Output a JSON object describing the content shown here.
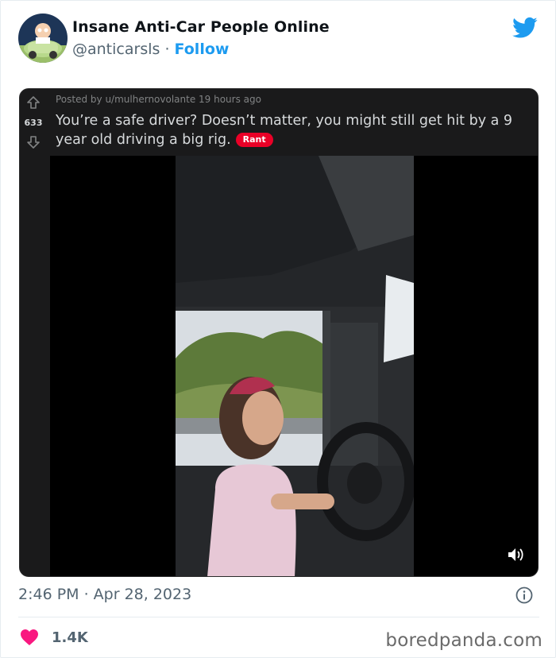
{
  "tweet": {
    "author_name": "Insane Anti-Car People Online",
    "handle": "@anticarsls",
    "separator": "·",
    "follow_label": "Follow",
    "timestamp": "2:46 PM · Apr 28, 2023",
    "like_count": "1.4K",
    "brand_color": "#1d9bf0",
    "like_color": "#f91880"
  },
  "reddit_post": {
    "score": "633",
    "meta": "Posted by u/mulhernovolante 19 hours ago",
    "title": "You’re a safe driver? Doesn’t matter, you might still get hit by a 9 year old driving a big rig.",
    "flair": "Rant",
    "flair_color": "#ea0027"
  },
  "icons": {
    "avatar": "avatar-cartoon-car",
    "brand": "twitter-bird-icon",
    "upvote": "upvote-arrow-icon",
    "downvote": "downvote-arrow-icon",
    "volume": "volume-icon",
    "info": "info-icon",
    "like": "heart-icon"
  },
  "watermark": "boredpanda.com"
}
